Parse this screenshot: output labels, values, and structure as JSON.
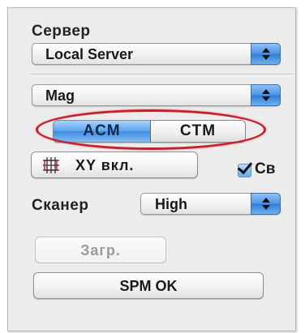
{
  "server": {
    "label": "Сервер",
    "selected": "Local Server"
  },
  "mode_select": {
    "selected": "Mag"
  },
  "mode_segment": {
    "options": [
      "ACM",
      "CTM"
    ],
    "active": "ACM",
    "highlight_color": "#c81f2a"
  },
  "xy_button": {
    "label": "XY вкл.",
    "icon": "xy-scan-icon"
  },
  "checkbox": {
    "label": "Св",
    "checked": true
  },
  "scanner": {
    "label": "Сканер",
    "selected": "High"
  },
  "load_button": {
    "label": "Загр.",
    "enabled": false
  },
  "spm_button": {
    "label": "SPM OK"
  },
  "colors": {
    "accent_blue": "#4c93e6",
    "panel_bg": "#ececec"
  }
}
